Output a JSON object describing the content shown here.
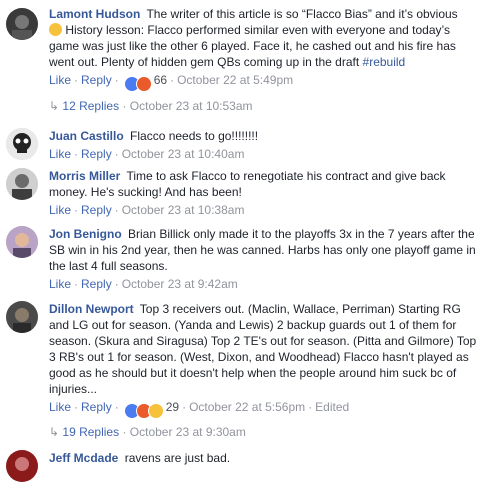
{
  "comments": [
    {
      "author": "Lamont Hudson",
      "text": "The writer of this article is so “Flacco Bias” and it’s obvious",
      "text2": "History lesson: Flacco performed similar even with everyone and today’s game was just like the other 6 played. Face it, he cashed out and his fire has went out. Plenty of hidden gem QBs coming up in the draft",
      "hashtag": "#rebuild",
      "like": "Like",
      "reply": "Reply",
      "reaction_count": "66",
      "time": "October 22 at 5:49pm",
      "replies_text": "12 Replies",
      "replies_time": "October 23 at 10:53am"
    },
    {
      "author": "Juan Castillo",
      "text": "Flacco needs to go!!!!!!!!",
      "like": "Like",
      "reply": "Reply",
      "time": "October 23 at 10:40am"
    },
    {
      "author": "Morris Miller",
      "text": "Time to ask Flacco to renegotiate his contract and give back money. He's sucking! And has been!",
      "like": "Like",
      "reply": "Reply",
      "time": "October 23 at 10:38am"
    },
    {
      "author": "Jon Benigno",
      "text": "Brian Billick only made it to the playoffs 3x in the 7 years after the SB win in his 2nd year, then he was canned. Harbs has only one playoff game in the last 4 full seasons.",
      "like": "Like",
      "reply": "Reply",
      "time": "October 23 at 9:42am"
    },
    {
      "author": "Dillon Newport",
      "text": "Top 3 receivers out. (Maclin, Wallace, Perriman) Starting RG and LG out for season. (Yanda and Lewis) 2 backup guards out 1 of them for season. (Skura and Siragusa) Top 2 TE's out for season. (Pitta and Gilmore) Top 3 RB's out 1 for season. (West, Dixon, and Woodhead) Flacco hasn't played as good as he should but it doesn't help when the people around him suck bc of injuries...",
      "like": "Like",
      "reply": "Reply",
      "reaction_count": "29",
      "time": "October 22 at 5:56pm",
      "edited": "Edited",
      "replies_text": "19 Replies",
      "replies_time": "October 23 at 9:30am"
    },
    {
      "author": "Jeff Mcdade",
      "text": "ravens are just bad."
    }
  ],
  "colors": {
    "link": "#365899",
    "action": "#4267b2",
    "meta": "#90949c"
  }
}
